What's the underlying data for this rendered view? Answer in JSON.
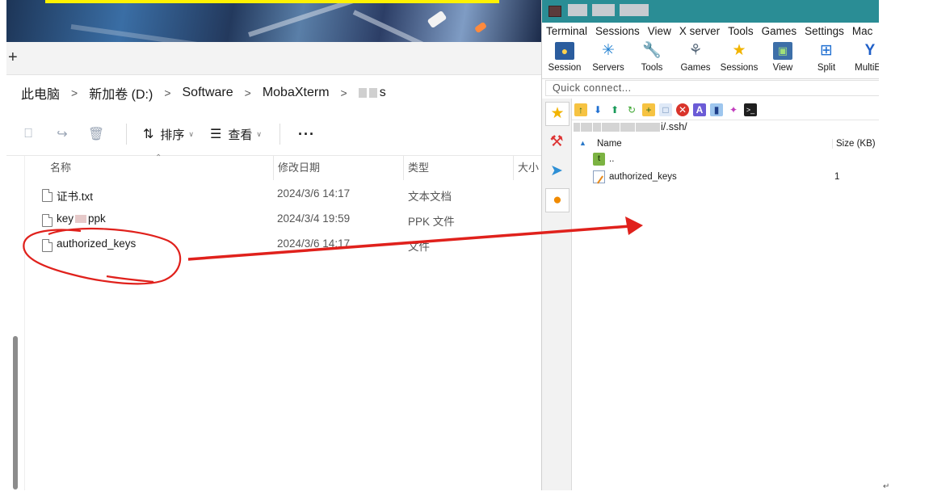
{
  "explorer": {
    "new_tab": "+",
    "breadcrumb": [
      "此电脑",
      "新加卷 (D:)",
      "Software",
      "MobaXterm"
    ],
    "breadcrumb_last": "s",
    "toolbar": {
      "sort_label": "排序",
      "view_label": "查看",
      "more_label": "···"
    },
    "columns": {
      "name": "名称",
      "date": "修改日期",
      "type": "类型",
      "size": "大小"
    },
    "files": [
      {
        "name": "证书.txt",
        "date": "2024/3/6 14:17",
        "type": "文本文档"
      },
      {
        "name_prefix": "key",
        "name_suffix": "ppk",
        "date": "2024/3/4 19:59",
        "type": "PPK 文件"
      },
      {
        "name": "authorized_keys",
        "date": "2024/3/6 14:17",
        "type": "文件"
      }
    ]
  },
  "moba": {
    "menu": [
      "Terminal",
      "Sessions",
      "View",
      "X server",
      "Tools",
      "Games",
      "Settings",
      "Mac"
    ],
    "ribbon": [
      {
        "label": "Session",
        "icon": "session-icon"
      },
      {
        "label": "Servers",
        "icon": "servers-icon"
      },
      {
        "label": "Tools",
        "icon": "tools-icon"
      },
      {
        "label": "Games",
        "icon": "games-icon"
      },
      {
        "label": "Sessions",
        "icon": "sessions-star-icon"
      },
      {
        "label": "View",
        "icon": "view-icon"
      },
      {
        "label": "Split",
        "icon": "split-icon"
      },
      {
        "label": "MultiEx",
        "icon": "multiexec-icon"
      }
    ],
    "quick_connect": "Quick connect...",
    "path_suffix": "i/.ssh/",
    "list_columns": {
      "name": "Name",
      "size": "Size (KB)"
    },
    "files": [
      {
        "name": "..",
        "size": ""
      },
      {
        "name": "authorized_keys",
        "size": "1"
      }
    ]
  },
  "doc_mark": "↵"
}
